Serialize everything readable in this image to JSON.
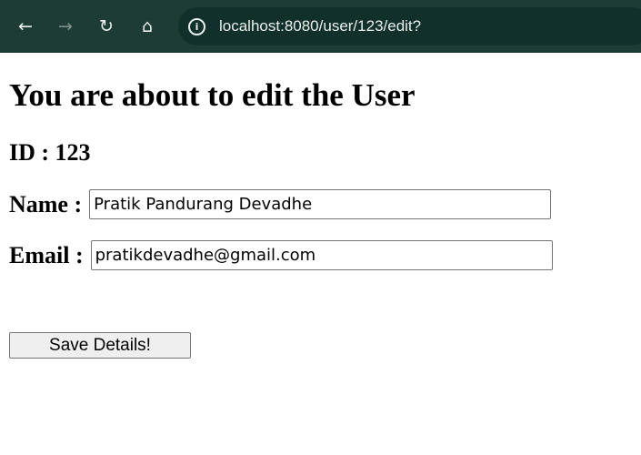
{
  "browser": {
    "back_icon": "←",
    "forward_icon": "→",
    "reload_icon": "↻",
    "home_icon": "⌂",
    "site_info_icon": "i",
    "url": "localhost:8080/user/123/edit?",
    "toolbar_color": "#1d3c36"
  },
  "page": {
    "title": "You are about to edit the User",
    "id_text": "ID : 123",
    "name_label": "Name :",
    "name_value": "Pratik Pandurang Devadhe",
    "email_label": "Email :",
    "email_value": "pratikdevadhe@gmail.com",
    "save_label": "Save Details!"
  }
}
